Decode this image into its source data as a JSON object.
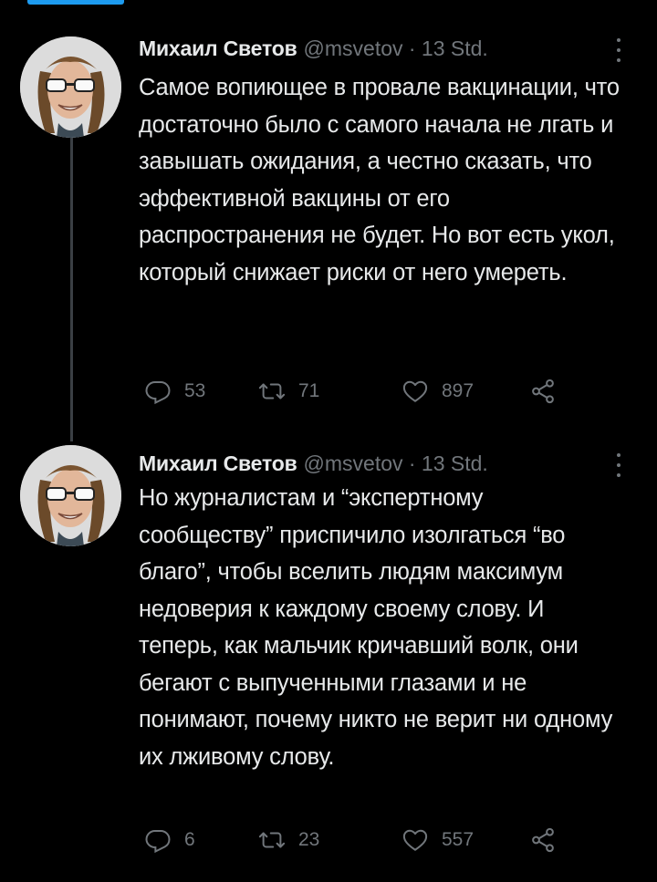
{
  "tweets": [
    {
      "author_name": "Михаил Светов",
      "handle_time": "@msvetov · 13 Std.",
      "text": "Самое вопиющее в провале вакцинации, что достаточно было с самого начала не лгать и завышать ожидания, а честно сказать, что эффективной вакцины от его распространения не будет. Но вот есть укол, который снижает риски от него умереть.",
      "replies": "53",
      "retweets": "71",
      "likes": "897"
    },
    {
      "author_name": "Михаил Светов",
      "handle_time": "@msvetov · 13 Std.",
      "text": "Но журналистам и “экспертному сообществу” приспичило изолгаться “во благо”, чтобы вселить людям максимум недоверия к каждому своему слову. И теперь, как мальчик кричавший волк, они бегают с выпученными глазами и не понимают, почему никто не верит ни одному их лживому слову.",
      "replies": "6",
      "retweets": "23",
      "likes": "557"
    }
  ],
  "icons": {
    "reply": "reply-icon",
    "retweet": "retweet-icon",
    "like": "heart-icon",
    "share": "share-icon",
    "more": "more-options-icon"
  },
  "colors": {
    "background": "#000000",
    "text": "#e7e9ea",
    "muted": "#71767b",
    "accent": "#1d9bf0"
  }
}
